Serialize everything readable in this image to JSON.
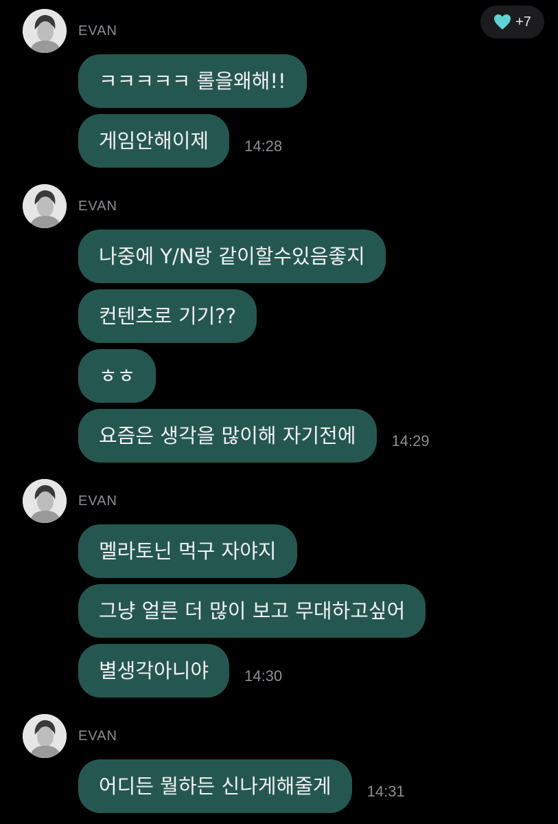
{
  "reaction": {
    "icon": "heart-icon",
    "count": "+7",
    "color": "#5fd3d3"
  },
  "bubble_color": "#255751",
  "groups": [
    {
      "sender": "EVAN",
      "messages": [
        {
          "text": "ㅋㅋㅋㅋㅋ 롤을왜해!!",
          "time": ""
        },
        {
          "text": "게임안해이제",
          "time": "14:28"
        }
      ]
    },
    {
      "sender": "EVAN",
      "messages": [
        {
          "text": "나중에 Y/N랑 같이할수있음좋지",
          "time": ""
        },
        {
          "text": "컨텐츠로 기기??",
          "time": ""
        },
        {
          "text": "ㅎㅎ",
          "time": ""
        },
        {
          "text": "요즘은 생각을 많이해 자기전에",
          "time": "14:29"
        }
      ]
    },
    {
      "sender": "EVAN",
      "messages": [
        {
          "text": "멜라토닌 먹구 자야지",
          "time": ""
        },
        {
          "text": "그냥 얼른 더 많이 보고 무대하고싶어",
          "time": ""
        },
        {
          "text": "별생각아니야",
          "time": "14:30"
        }
      ]
    },
    {
      "sender": "EVAN",
      "messages": [
        {
          "text": "어디든 뭘하든 신나게해줄게",
          "time": "14:31"
        }
      ]
    }
  ]
}
